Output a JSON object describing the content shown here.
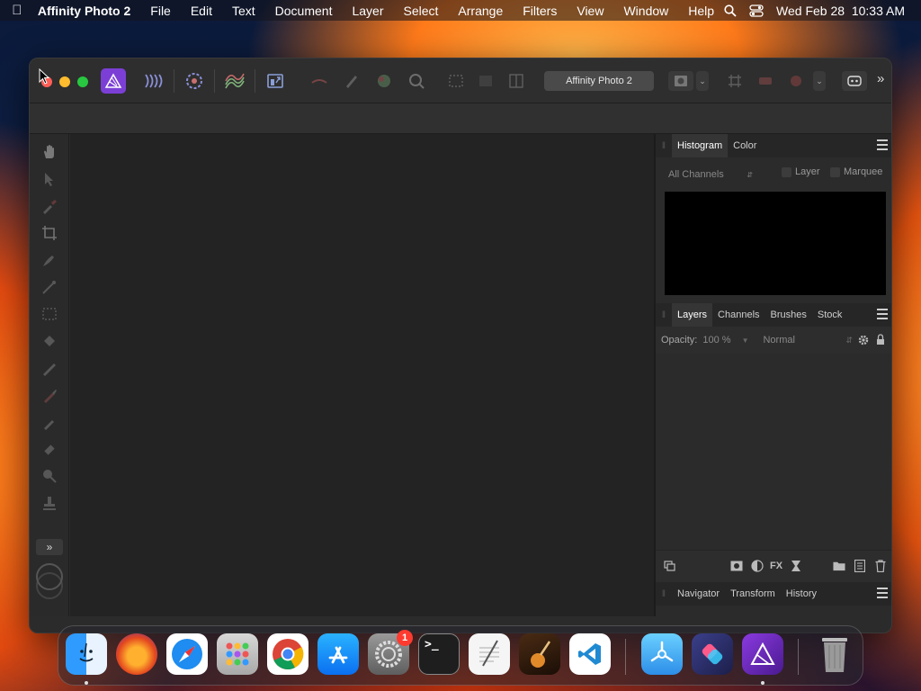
{
  "menubar": {
    "app_name": "Affinity Photo 2",
    "items": [
      "File",
      "Edit",
      "Text",
      "Document",
      "Layer",
      "Select",
      "Arrange",
      "Filters",
      "View",
      "Window",
      "Help"
    ],
    "clock": "Wed Feb 28  10:33 AM"
  },
  "toolbar": {
    "document_title": "Affinity Photo 2"
  },
  "histogram_panel": {
    "tabs": [
      "Histogram",
      "Color"
    ],
    "channel_select": "All Channels",
    "layer_label": "Layer",
    "marquee_label": "Marquee"
  },
  "layers_panel": {
    "tabs": [
      "Layers",
      "Channels",
      "Brushes",
      "Stock"
    ],
    "opacity_label": "Opacity:",
    "opacity_value": "100 %",
    "blend_mode": "Normal"
  },
  "bottom_panel": {
    "tabs": [
      "Navigator",
      "Transform",
      "History"
    ]
  },
  "dock": {
    "settings_badge": "1"
  },
  "colors": {
    "accent_purple": "#7b3fd6",
    "window_bg": "#2b2b2b",
    "canvas_bg": "#232323"
  }
}
